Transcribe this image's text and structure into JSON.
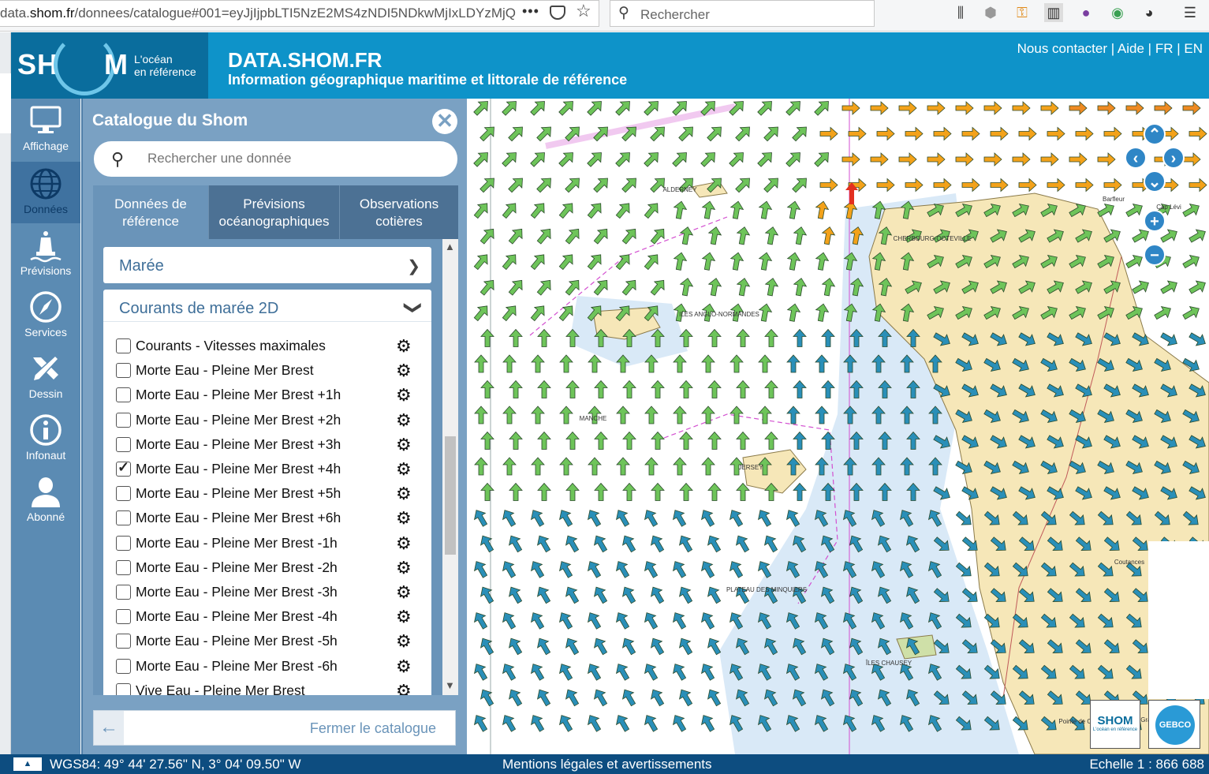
{
  "browser": {
    "url_prefix": "data.",
    "url_domain": "shom.fr",
    "url_rest": "/donnees/catalogue#001=eyJjIjpbLTI5NzE2MS4zNDI5NDkwMjIxLDYzMjQ",
    "url_more": "•••",
    "search_placeholder": "Rechercher"
  },
  "header": {
    "logo_left": "SH",
    "logo_right": "M",
    "logo_tagline_1": "L'océan",
    "logo_tagline_2": "en référence",
    "title": "DATA.SHOM.FR",
    "subtitle": "Information géographique maritime et littorale de référence",
    "links": [
      "Nous contacter",
      "Aide",
      "FR",
      "EN"
    ],
    "separator": " | "
  },
  "sidebar": {
    "items": [
      {
        "label": "Affichage",
        "icon": "monitor-icon",
        "active": false
      },
      {
        "label": "Données",
        "icon": "globe-icon",
        "active": true
      },
      {
        "label": "Prévisions",
        "icon": "buoy-icon",
        "active": false
      },
      {
        "label": "Services",
        "icon": "compass-icon",
        "active": false
      },
      {
        "label": "Dessin",
        "icon": "draw-tools-icon",
        "active": false
      },
      {
        "label": "Infonaut",
        "icon": "info-icon",
        "active": false
      },
      {
        "label": "Abonné",
        "icon": "user-icon",
        "active": false
      }
    ]
  },
  "catalogue": {
    "title": "Catalogue du Shom",
    "search_placeholder": "Rechercher une donnée",
    "tabs": [
      {
        "line1": "Données de",
        "line2": "référence",
        "active": true
      },
      {
        "line1": "Prévisions",
        "line2": "océanographiques",
        "active": false
      },
      {
        "line1": "Observations",
        "line2": "cotières",
        "active": false
      }
    ],
    "sections": [
      {
        "label": "Marée",
        "expanded": false
      },
      {
        "label": "Courants de marée 2D",
        "expanded": true
      }
    ],
    "layers": [
      {
        "label": "Courants - Vitesses maximales",
        "checked": false
      },
      {
        "label": "Morte Eau - Pleine Mer Brest",
        "checked": false
      },
      {
        "label": "Morte Eau - Pleine Mer Brest +1h",
        "checked": false
      },
      {
        "label": "Morte Eau - Pleine Mer Brest +2h",
        "checked": false
      },
      {
        "label": "Morte Eau - Pleine Mer Brest +3h",
        "checked": false
      },
      {
        "label": "Morte Eau - Pleine Mer Brest +4h",
        "checked": true
      },
      {
        "label": "Morte Eau - Pleine Mer Brest +5h",
        "checked": false
      },
      {
        "label": "Morte Eau - Pleine Mer Brest +6h",
        "checked": false
      },
      {
        "label": "Morte Eau - Pleine Mer Brest -1h",
        "checked": false
      },
      {
        "label": "Morte Eau - Pleine Mer Brest -2h",
        "checked": false
      },
      {
        "label": "Morte Eau - Pleine Mer Brest -3h",
        "checked": false
      },
      {
        "label": "Morte Eau - Pleine Mer Brest -4h",
        "checked": false
      },
      {
        "label": "Morte Eau - Pleine Mer Brest -5h",
        "checked": false
      },
      {
        "label": "Morte Eau - Pleine Mer Brest -6h",
        "checked": false
      },
      {
        "label": "Vive Eau - Pleine Mer Brest",
        "checked": false
      }
    ],
    "close_label": "Fermer le catalogue"
  },
  "map": {
    "labels": [
      "CHERBOURG-OCTEVILLE",
      "JERSEY",
      "ILES ANGLO-NORMANDES",
      "PLATEAU DES MINQUIERS",
      "ALDERNEY",
      "Granville",
      "Coutances",
      "Barfleur",
      "Cap Lévi",
      "Pointe de Champeaux",
      "MANCHE",
      "ÎLES CHAUSEY"
    ],
    "arrow_colors": {
      "slow": "#2a8fb8",
      "medium": "#6ec45a",
      "fast": "#f3a21a",
      "fastest": "#e23020"
    },
    "land_color": "#f6e7b8",
    "shallow_color": "#cfe3f5",
    "chart_lines_color": "#d34fd0",
    "logo_shom_text": "SHOM",
    "logo_shom_caption": "L'océan en référence",
    "logo_gebco_text": "GEBCO"
  },
  "status": {
    "toggle": "▲",
    "coords": "WGS84: 49° 44' 27.56\" N, 3° 04' 09.50\" W",
    "legal": "Mentions légales et avertissements",
    "scale": "Echelle 1 : 866 688"
  }
}
